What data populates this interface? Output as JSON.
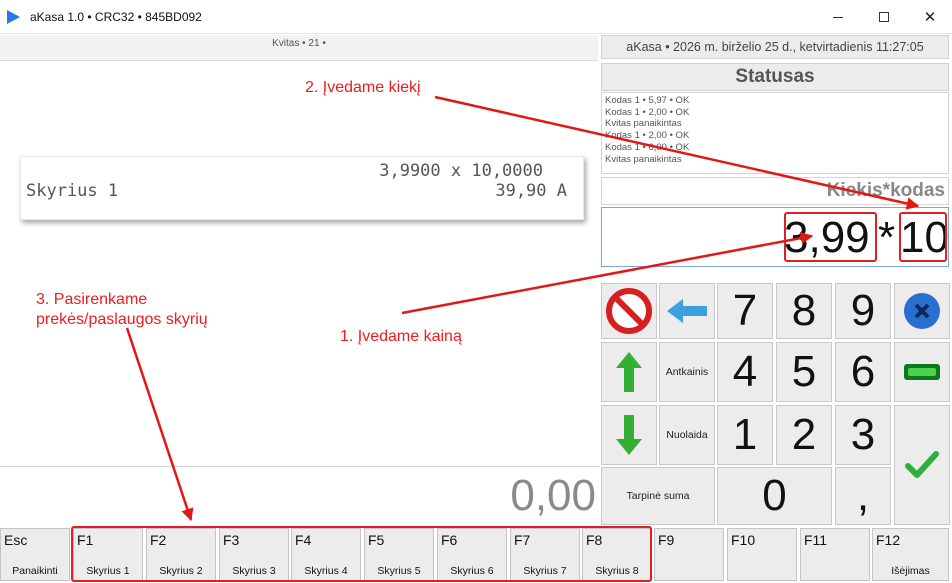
{
  "window": {
    "title": "aKasa 1.0 • CRC32 • 845BD092",
    "minimize_icon": "minimize-icon",
    "maximize_icon": "maximize-icon",
    "close_icon": "close-icon",
    "close_glyph": "✕"
  },
  "receipt": {
    "header": "Kvitas • 21 •",
    "line": {
      "qty_expr": "3,9900 x 10,0000",
      "name": "Skyrius 1",
      "total": "39,90 A"
    },
    "grand_total": "0,00"
  },
  "panel": {
    "datetime": "aKasa • 2026 m. birželio 25 d., ketvirtadienis 11:27:05",
    "status_title": "Statusas",
    "status_log": [
      "Kodas 1 • 5,97 • OK",
      "Kodas 1 • 2,00 • OK",
      "Kvitas panaikintas",
      "Kodas 1 • 2,00 • OK",
      "Kodas 1 • 6,00 • OK",
      "Kvitas panaikintas"
    ],
    "mode_label": "Kiekis*kodas",
    "entry": {
      "price": "3,99",
      "separator": "*",
      "quantity": "10"
    }
  },
  "keypad": {
    "digits": {
      "seven": "7",
      "eight": "8",
      "nine": "9",
      "four": "4",
      "five": "5",
      "six": "6",
      "one": "1",
      "two": "2",
      "three": "3",
      "zero": "0",
      "comma": ","
    },
    "antkainis": "Antkainis",
    "nuolaida": "Nuolaida",
    "tarpine_suma": "Tarpinė suma",
    "colors": {
      "cancel_red": "#d42020",
      "arrow_blue": "#3aa0e0",
      "arrow_green": "#33b033",
      "ok_green": "#2fae3a",
      "clear_blue": "#2a6fd0"
    }
  },
  "fkeys": [
    {
      "key": "Esc",
      "label": "Panaikinti"
    },
    {
      "key": "F1",
      "label": "Skyrius 1"
    },
    {
      "key": "F2",
      "label": "Skyrius 2"
    },
    {
      "key": "F3",
      "label": "Skyrius 3"
    },
    {
      "key": "F4",
      "label": "Skyrius 4"
    },
    {
      "key": "F5",
      "label": "Skyrius 5"
    },
    {
      "key": "F6",
      "label": "Skyrius 6"
    },
    {
      "key": "F7",
      "label": "Skyrius 7"
    },
    {
      "key": "F8",
      "label": "Skyrius 8"
    },
    {
      "key": "F9",
      "label": ""
    },
    {
      "key": "F10",
      "label": ""
    },
    {
      "key": "F11",
      "label": ""
    },
    {
      "key": "F12",
      "label": "Išėjimas"
    }
  ],
  "annotations": {
    "step1": "1. Įvedame kainą",
    "step2": "2. Įvedame kiekį",
    "step3_line1": "3. Pasirenkame",
    "step3_line2": "prekės/paslaugos skyrių",
    "color": "#ee1c1c"
  }
}
